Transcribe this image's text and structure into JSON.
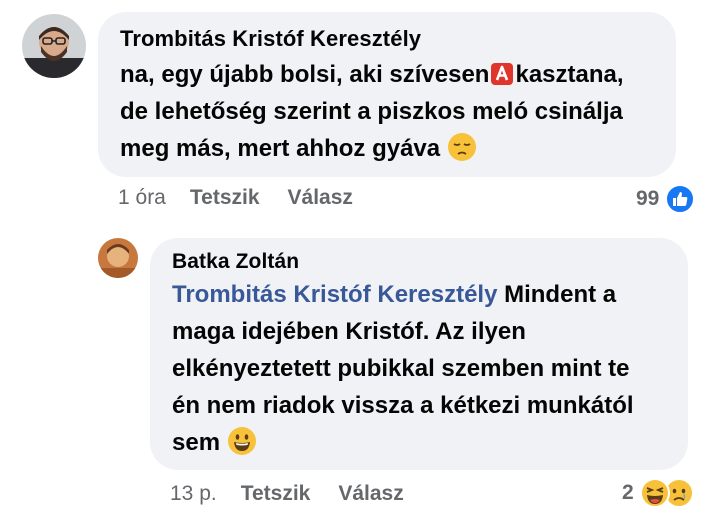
{
  "comment": {
    "author": "Trombitás Kristóf Keresztély",
    "lines": [
      "na, egy újabb bolsi, aki szívesen",
      "kasztana,",
      "de lehetőség szerint a piszkos meló csinálja",
      "meg más, mert ahhoz gyáva"
    ],
    "inline_icon": "red-a-button-icon",
    "end_emoji": "pensive-face-icon",
    "time": "1 óra",
    "like_label": "Tetszik",
    "reply_label": "Válasz",
    "reaction_count": "99",
    "reaction_icons": [
      "like-icon"
    ]
  },
  "reply": {
    "author": "Batka Zoltán",
    "mention": "Trombitás Kristóf Keresztély",
    "lines": [
      "Mindent a",
      "maga idejében Kristóf. Az ilyen",
      "elkényeztetett pubikkal szemben mint te",
      "én nem riadok vissza a kétkezi munkától",
      "sem"
    ],
    "end_emoji": "grinning-face-icon",
    "time": "13 p.",
    "like_label": "Tetszik",
    "reply_label": "Válasz",
    "reaction_count": "2",
    "reaction_icons": [
      "laughing-face-icon",
      "sad-face-icon"
    ]
  },
  "colors": {
    "bubble": "#f0f2f5",
    "mention": "#385898",
    "meta": "#65676b",
    "like_blue": "#1877f2"
  }
}
